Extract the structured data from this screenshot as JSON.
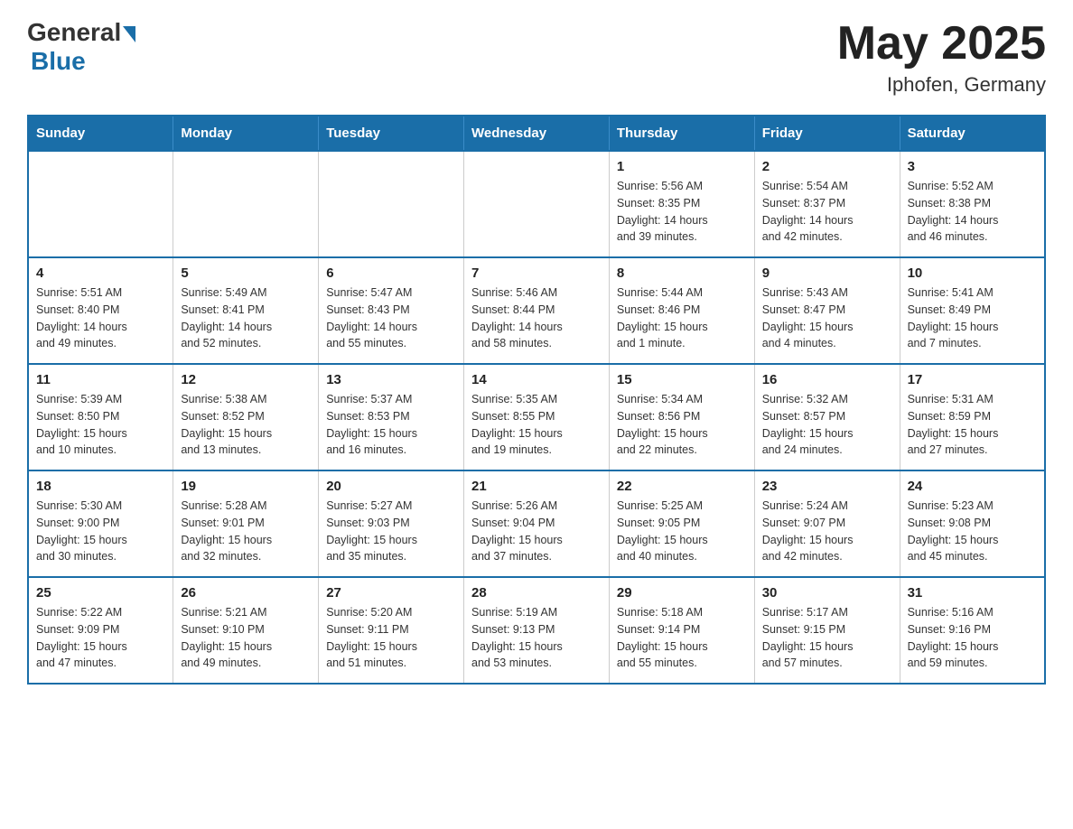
{
  "header": {
    "logo_general": "General",
    "logo_blue": "Blue",
    "title": "May 2025",
    "location": "Iphofen, Germany"
  },
  "days_of_week": [
    "Sunday",
    "Monday",
    "Tuesday",
    "Wednesday",
    "Thursday",
    "Friday",
    "Saturday"
  ],
  "weeks": [
    [
      {
        "day": "",
        "info": ""
      },
      {
        "day": "",
        "info": ""
      },
      {
        "day": "",
        "info": ""
      },
      {
        "day": "",
        "info": ""
      },
      {
        "day": "1",
        "info": "Sunrise: 5:56 AM\nSunset: 8:35 PM\nDaylight: 14 hours\nand 39 minutes."
      },
      {
        "day": "2",
        "info": "Sunrise: 5:54 AM\nSunset: 8:37 PM\nDaylight: 14 hours\nand 42 minutes."
      },
      {
        "day": "3",
        "info": "Sunrise: 5:52 AM\nSunset: 8:38 PM\nDaylight: 14 hours\nand 46 minutes."
      }
    ],
    [
      {
        "day": "4",
        "info": "Sunrise: 5:51 AM\nSunset: 8:40 PM\nDaylight: 14 hours\nand 49 minutes."
      },
      {
        "day": "5",
        "info": "Sunrise: 5:49 AM\nSunset: 8:41 PM\nDaylight: 14 hours\nand 52 minutes."
      },
      {
        "day": "6",
        "info": "Sunrise: 5:47 AM\nSunset: 8:43 PM\nDaylight: 14 hours\nand 55 minutes."
      },
      {
        "day": "7",
        "info": "Sunrise: 5:46 AM\nSunset: 8:44 PM\nDaylight: 14 hours\nand 58 minutes."
      },
      {
        "day": "8",
        "info": "Sunrise: 5:44 AM\nSunset: 8:46 PM\nDaylight: 15 hours\nand 1 minute."
      },
      {
        "day": "9",
        "info": "Sunrise: 5:43 AM\nSunset: 8:47 PM\nDaylight: 15 hours\nand 4 minutes."
      },
      {
        "day": "10",
        "info": "Sunrise: 5:41 AM\nSunset: 8:49 PM\nDaylight: 15 hours\nand 7 minutes."
      }
    ],
    [
      {
        "day": "11",
        "info": "Sunrise: 5:39 AM\nSunset: 8:50 PM\nDaylight: 15 hours\nand 10 minutes."
      },
      {
        "day": "12",
        "info": "Sunrise: 5:38 AM\nSunset: 8:52 PM\nDaylight: 15 hours\nand 13 minutes."
      },
      {
        "day": "13",
        "info": "Sunrise: 5:37 AM\nSunset: 8:53 PM\nDaylight: 15 hours\nand 16 minutes."
      },
      {
        "day": "14",
        "info": "Sunrise: 5:35 AM\nSunset: 8:55 PM\nDaylight: 15 hours\nand 19 minutes."
      },
      {
        "day": "15",
        "info": "Sunrise: 5:34 AM\nSunset: 8:56 PM\nDaylight: 15 hours\nand 22 minutes."
      },
      {
        "day": "16",
        "info": "Sunrise: 5:32 AM\nSunset: 8:57 PM\nDaylight: 15 hours\nand 24 minutes."
      },
      {
        "day": "17",
        "info": "Sunrise: 5:31 AM\nSunset: 8:59 PM\nDaylight: 15 hours\nand 27 minutes."
      }
    ],
    [
      {
        "day": "18",
        "info": "Sunrise: 5:30 AM\nSunset: 9:00 PM\nDaylight: 15 hours\nand 30 minutes."
      },
      {
        "day": "19",
        "info": "Sunrise: 5:28 AM\nSunset: 9:01 PM\nDaylight: 15 hours\nand 32 minutes."
      },
      {
        "day": "20",
        "info": "Sunrise: 5:27 AM\nSunset: 9:03 PM\nDaylight: 15 hours\nand 35 minutes."
      },
      {
        "day": "21",
        "info": "Sunrise: 5:26 AM\nSunset: 9:04 PM\nDaylight: 15 hours\nand 37 minutes."
      },
      {
        "day": "22",
        "info": "Sunrise: 5:25 AM\nSunset: 9:05 PM\nDaylight: 15 hours\nand 40 minutes."
      },
      {
        "day": "23",
        "info": "Sunrise: 5:24 AM\nSunset: 9:07 PM\nDaylight: 15 hours\nand 42 minutes."
      },
      {
        "day": "24",
        "info": "Sunrise: 5:23 AM\nSunset: 9:08 PM\nDaylight: 15 hours\nand 45 minutes."
      }
    ],
    [
      {
        "day": "25",
        "info": "Sunrise: 5:22 AM\nSunset: 9:09 PM\nDaylight: 15 hours\nand 47 minutes."
      },
      {
        "day": "26",
        "info": "Sunrise: 5:21 AM\nSunset: 9:10 PM\nDaylight: 15 hours\nand 49 minutes."
      },
      {
        "day": "27",
        "info": "Sunrise: 5:20 AM\nSunset: 9:11 PM\nDaylight: 15 hours\nand 51 minutes."
      },
      {
        "day": "28",
        "info": "Sunrise: 5:19 AM\nSunset: 9:13 PM\nDaylight: 15 hours\nand 53 minutes."
      },
      {
        "day": "29",
        "info": "Sunrise: 5:18 AM\nSunset: 9:14 PM\nDaylight: 15 hours\nand 55 minutes."
      },
      {
        "day": "30",
        "info": "Sunrise: 5:17 AM\nSunset: 9:15 PM\nDaylight: 15 hours\nand 57 minutes."
      },
      {
        "day": "31",
        "info": "Sunrise: 5:16 AM\nSunset: 9:16 PM\nDaylight: 15 hours\nand 59 minutes."
      }
    ]
  ]
}
